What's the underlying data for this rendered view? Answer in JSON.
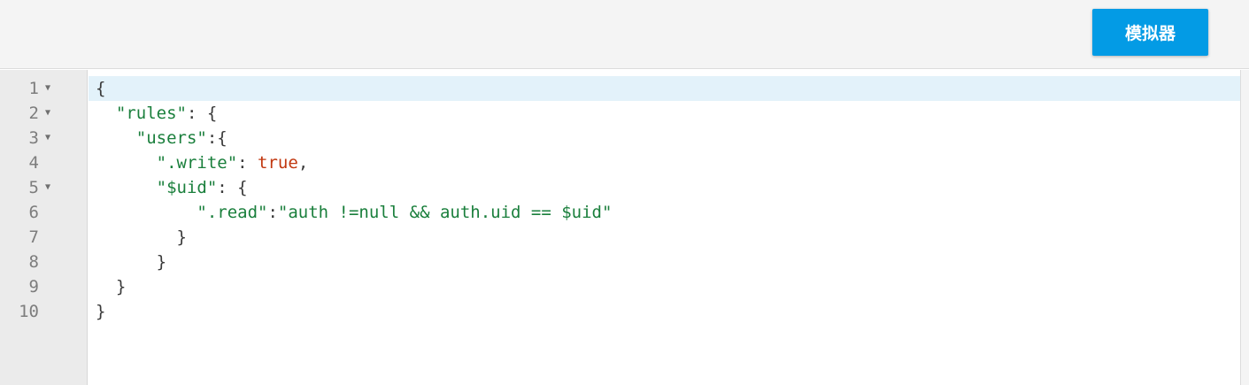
{
  "toolbar": {
    "simulator_label": "模拟器",
    "accent_color": "#039be5"
  },
  "editor": {
    "active_line": 1,
    "fold_icon": "triangle-down-icon",
    "lines": [
      {
        "number": "1",
        "foldable": true,
        "tokens": [
          [
            "p",
            "{"
          ]
        ]
      },
      {
        "number": "2",
        "foldable": true,
        "tokens": [
          [
            "p",
            "  "
          ],
          [
            "str",
            "\"rules\""
          ],
          [
            "p",
            ": {"
          ]
        ]
      },
      {
        "number": "3",
        "foldable": true,
        "tokens": [
          [
            "p",
            "    "
          ],
          [
            "str",
            "\"users\""
          ],
          [
            "p",
            ":{"
          ]
        ]
      },
      {
        "number": "4",
        "foldable": false,
        "tokens": [
          [
            "p",
            "      "
          ],
          [
            "str",
            "\".write\""
          ],
          [
            "p",
            ": "
          ],
          [
            "kw",
            "true"
          ],
          [
            "p",
            ","
          ]
        ]
      },
      {
        "number": "5",
        "foldable": true,
        "tokens": [
          [
            "p",
            "      "
          ],
          [
            "str",
            "\"$uid\""
          ],
          [
            "p",
            ": {"
          ]
        ]
      },
      {
        "number": "6",
        "foldable": false,
        "tokens": [
          [
            "p",
            "          "
          ],
          [
            "str",
            "\".read\""
          ],
          [
            "p",
            ":"
          ],
          [
            "str",
            "\"auth !=null && auth.uid == $uid\""
          ]
        ]
      },
      {
        "number": "7",
        "foldable": false,
        "tokens": [
          [
            "p",
            "        }"
          ]
        ]
      },
      {
        "number": "8",
        "foldable": false,
        "tokens": [
          [
            "p",
            "      }"
          ]
        ]
      },
      {
        "number": "9",
        "foldable": false,
        "tokens": [
          [
            "p",
            "  }"
          ]
        ]
      },
      {
        "number": "10",
        "foldable": false,
        "tokens": [
          [
            "p",
            "}"
          ]
        ]
      }
    ]
  }
}
